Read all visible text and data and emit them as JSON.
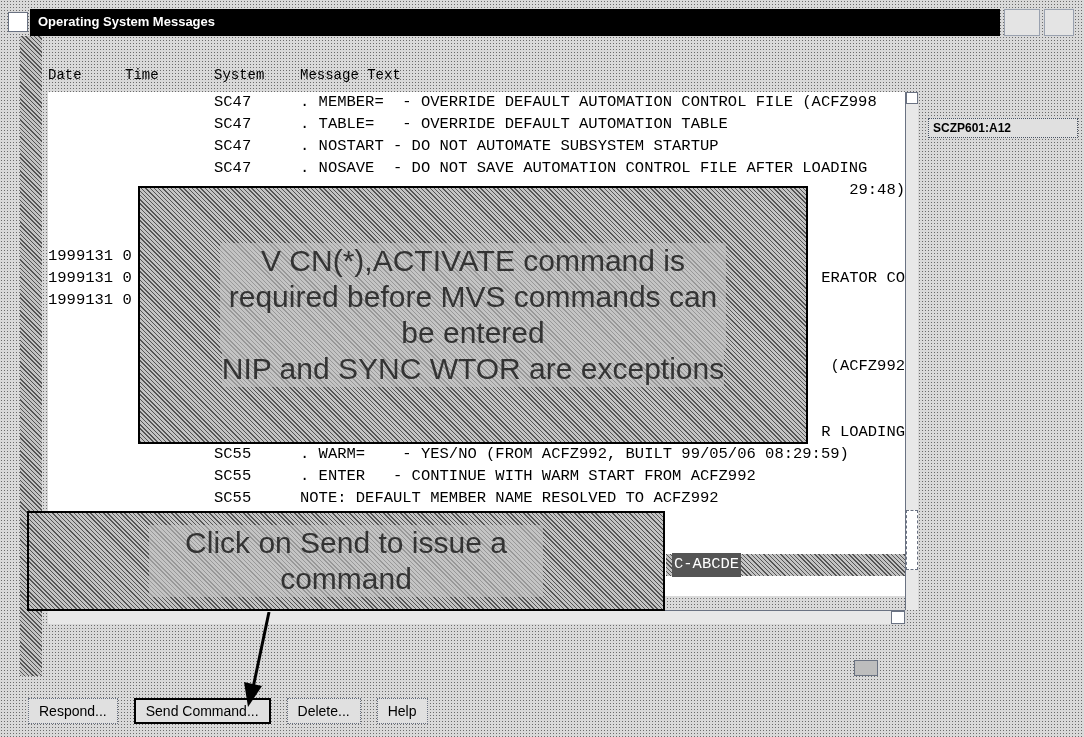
{
  "window": {
    "title": "Operating System Messages"
  },
  "system_label": "SCZP601:A12",
  "columns": [
    "Date",
    "Time",
    "System",
    "Message Text"
  ],
  "rows": [
    {
      "kind": "line",
      "system": "SC47",
      "message": ". MEMBER=  - OVERRIDE DEFAULT AUTOMATION CONTROL FILE (ACFZ998"
    },
    {
      "kind": "line",
      "system": "SC47",
      "message": ". TABLE=   - OVERRIDE DEFAULT AUTOMATION TABLE"
    },
    {
      "kind": "line",
      "system": "SC47",
      "message": ". NOSTART - DO NOT AUTOMATE SUBSYSTEM STARTUP"
    },
    {
      "kind": "line",
      "system": "SC47",
      "message": ". NOSAVE  - DO NOT SAVE AUTOMATION CONTROL FILE AFTER LOADING"
    },
    {
      "kind": "partial",
      "tail": "29:48)"
    },
    {
      "kind": "partial"
    },
    {
      "kind": "partial"
    },
    {
      "kind": "partial",
      "date": "1999131 0"
    },
    {
      "kind": "partial",
      "date": "1999131 0",
      "tail": "ERATOR CO"
    },
    {
      "kind": "partial",
      "date": "1999131 0"
    },
    {
      "kind": "partial"
    },
    {
      "kind": "partial"
    },
    {
      "kind": "partial",
      "tail": "(ACFZ992"
    },
    {
      "kind": "partial"
    },
    {
      "kind": "partial"
    },
    {
      "kind": "partial",
      "tail": "R LOADING"
    },
    {
      "kind": "line",
      "system": "SC55",
      "message": ". WARM=    - YES/NO (FROM ACFZ992, BUILT 99/05/06 08:29:59)"
    },
    {
      "kind": "line",
      "system": "SC55",
      "message": ". ENTER   - CONTINUE WITH WARM START FROM ACFZ992"
    },
    {
      "kind": "line",
      "system": "SC55",
      "message": "NOTE: DEFAULT MEMBER NAME RESOLVED TO ACFZ992"
    },
    {
      "kind": "partial"
    },
    {
      "kind": "partial"
    },
    {
      "kind": "command",
      "text": "C-ABCDE"
    }
  ],
  "callouts": [
    {
      "paragraphs": [
        "V CN(*),ACTIVATE command is required before MVS commands can be entered",
        "NIP and SYNC WTOR are exceptions"
      ]
    },
    {
      "paragraphs": [
        "Click on Send to issue a command"
      ]
    }
  ],
  "buttons": [
    {
      "label": "Respond...",
      "focused": false
    },
    {
      "label": "Send Command...",
      "focused": true
    },
    {
      "label": "Delete...",
      "focused": false
    },
    {
      "label": "Help",
      "focused": false
    }
  ]
}
